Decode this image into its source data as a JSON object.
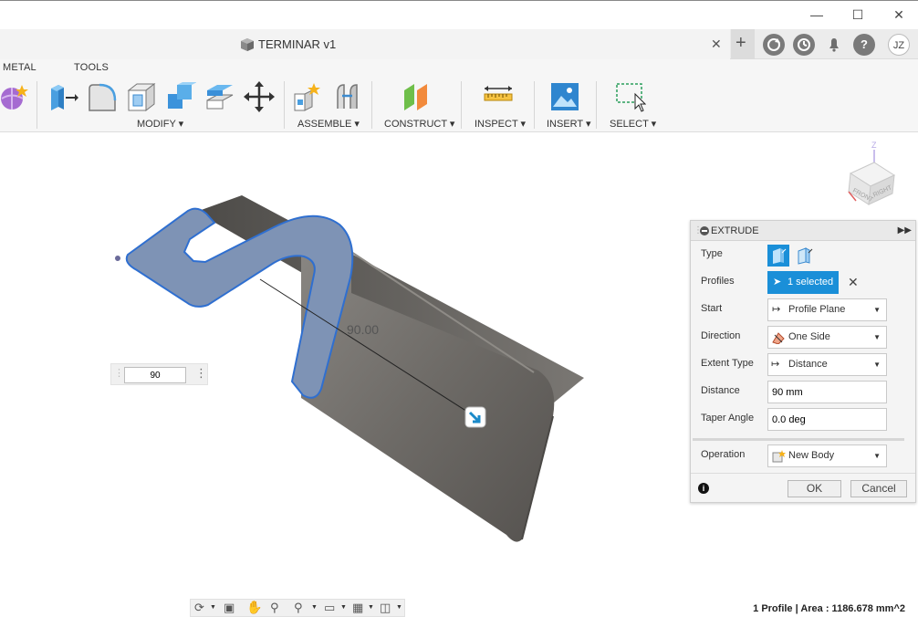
{
  "document": {
    "title": "TERMINAR v1"
  },
  "account": {
    "initials": "JZ"
  },
  "toolbar": {
    "tabs": {
      "sheet_metal": "METAL",
      "tools": "TOOLS"
    },
    "groups": {
      "modify": "MODIFY ▾",
      "assemble": "ASSEMBLE ▾",
      "construct": "CONSTRUCT ▾",
      "inspect": "INSPECT ▾",
      "insert": "INSERT ▾",
      "select": "SELECT ▾"
    }
  },
  "canvas": {
    "dimension_label": "90.00",
    "distance_input": "90"
  },
  "extrude_panel": {
    "title": "EXTRUDE",
    "type_label": "Type",
    "profiles_label": "Profiles",
    "profiles_value": "1 selected",
    "start_label": "Start",
    "start_value": "Profile Plane",
    "direction_label": "Direction",
    "direction_value": "One Side",
    "extent_label": "Extent Type",
    "extent_value": "Distance",
    "distance_label": "Distance",
    "distance_value": "90 mm",
    "taper_label": "Taper Angle",
    "taper_value": "0.0 deg",
    "operation_label": "Operation",
    "operation_value": "New Body",
    "ok_label": "OK",
    "cancel_label": "Cancel"
  },
  "viewcube": {
    "front": "FRONT",
    "right": "RIGHT",
    "axis_z": "Z"
  },
  "status": {
    "text": "1 Profile | Area : 1186.678 mm^2"
  },
  "colors": {
    "accent": "#0696d7",
    "profile_fill": "#7e93b5",
    "profile_edge": "#2f6fd0",
    "body": "#6f6d6a"
  }
}
